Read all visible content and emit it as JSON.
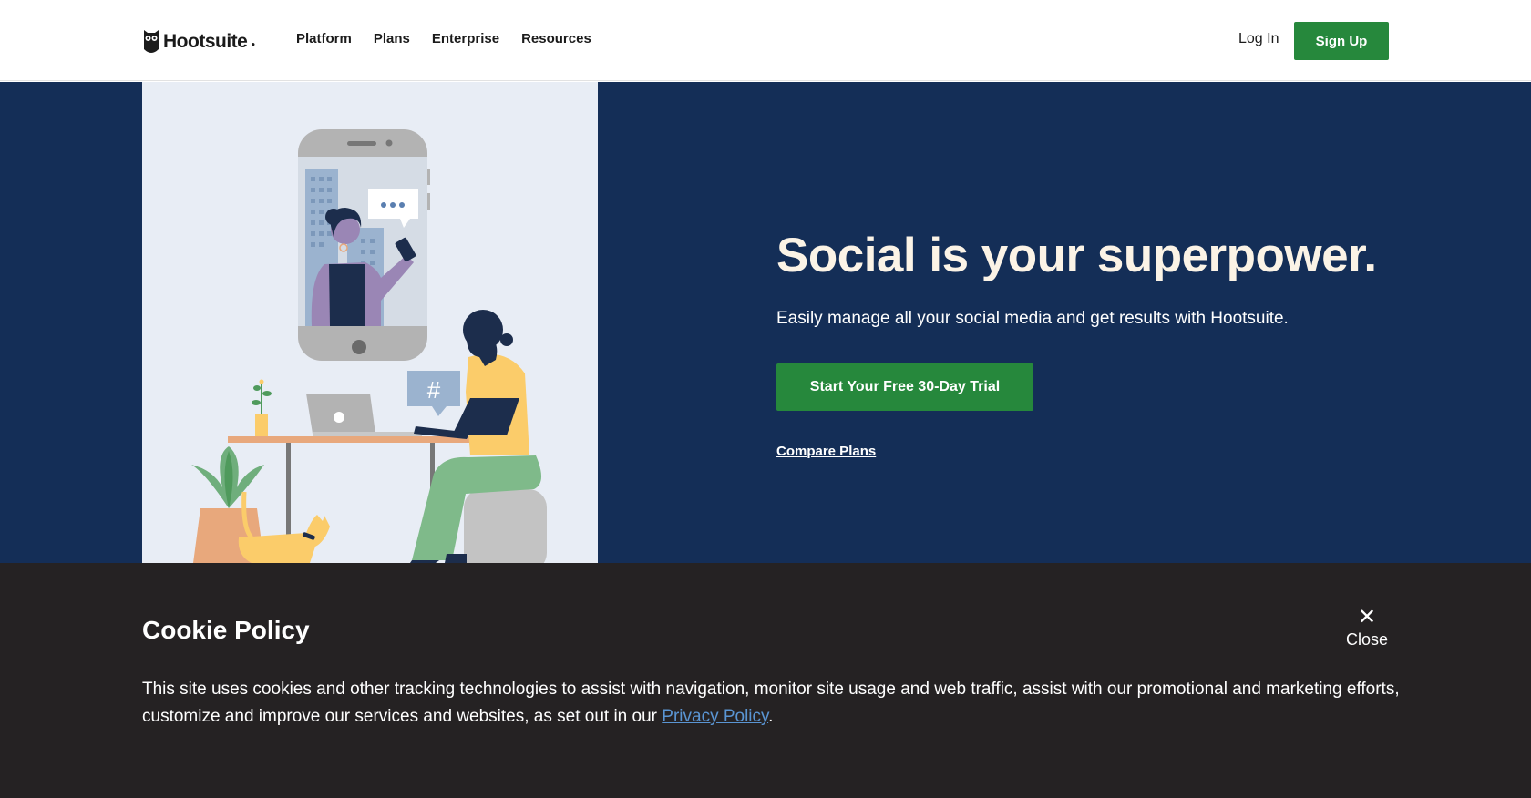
{
  "header": {
    "logo_text": "Hootsuite",
    "nav": [
      {
        "label": "Platform"
      },
      {
        "label": "Plans"
      },
      {
        "label": "Enterprise"
      },
      {
        "label": "Resources"
      }
    ],
    "login_label": "Log In",
    "signup_label": "Sign Up"
  },
  "hero": {
    "title": "Social is your superpower.",
    "subtitle": "Easily manage all your social media and get results with Hootsuite.",
    "cta_label": "Start Your Free 30-Day Trial",
    "compare_label": "Compare Plans",
    "bubble_hashtag": "#"
  },
  "cookie": {
    "title": "Cookie Policy",
    "close_label": "Close",
    "close_icon": "✕",
    "text_before": "This site uses cookies and other tracking technologies to assist with navigation, monitor site usage and web traffic, assist with our promotional and marketing efforts, customize and improve our services and websites, as set out in our ",
    "link_label": "Privacy Policy",
    "text_after": "."
  },
  "colors": {
    "brand_green": "#26883c",
    "hero_navy": "#142e57",
    "cookie_bg": "#252223",
    "link_blue": "#5a95d3"
  }
}
